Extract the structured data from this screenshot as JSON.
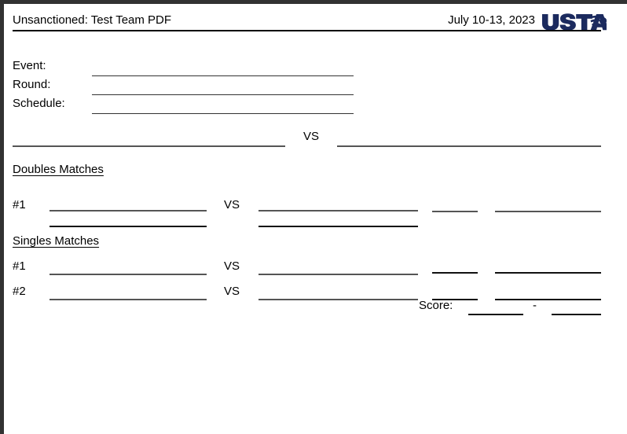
{
  "viewer": {
    "chrome_color": "#323232",
    "page_background": "#ffffff"
  },
  "header": {
    "title": "Unsanctioned: Test Team PDF",
    "date": "July 10-13, 2023",
    "logo": {
      "icon": "usta-logo",
      "wordmark": "USTA",
      "color": "#1b2a5e"
    }
  },
  "fields": [
    {
      "label": "Event:",
      "value": ""
    },
    {
      "label": "Round:",
      "value": ""
    },
    {
      "label": "Schedule:",
      "value": ""
    }
  ],
  "teams": {
    "home": "",
    "vs_label": "VS",
    "away": ""
  },
  "sections": [
    {
      "heading": "Doubles Matches",
      "matches": [
        {
          "number": "#1",
          "vs_label": "VS",
          "home_players": [
            "",
            ""
          ],
          "away_players": [
            "",
            ""
          ],
          "score_short": "",
          "score_long": ""
        }
      ]
    },
    {
      "heading": "Singles Matches",
      "matches": [
        {
          "number": "#1",
          "vs_label": "VS",
          "home_players": [
            ""
          ],
          "away_players": [
            ""
          ],
          "score_short": "",
          "score_long": ""
        },
        {
          "number": "#2",
          "vs_label": "VS",
          "home_players": [
            ""
          ],
          "away_players": [
            ""
          ],
          "score_short": "",
          "score_long": ""
        }
      ]
    }
  ],
  "score_footer": {
    "label": "Score:",
    "home_score": "",
    "separator": "-",
    "away_score": ""
  }
}
